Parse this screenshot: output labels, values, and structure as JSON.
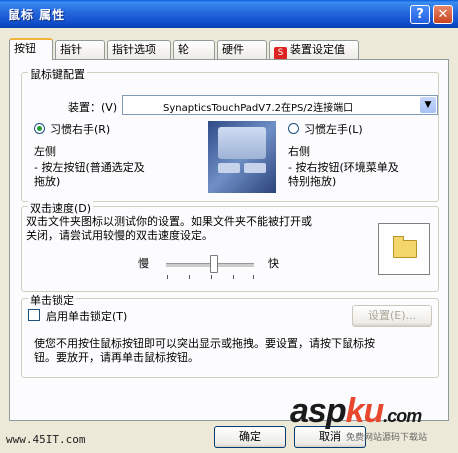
{
  "window": {
    "title": "鼠标 属性",
    "help_glyph": "?",
    "close_glyph": "✕"
  },
  "tabs": [
    {
      "label": "按钮"
    },
    {
      "label": "指针"
    },
    {
      "label": "指针选项"
    },
    {
      "label": "轮"
    },
    {
      "label": "硬件"
    },
    {
      "label": "装置设定值"
    }
  ],
  "mouse_config": {
    "legend": "鼠标键配置",
    "device_label": "装置：(V)",
    "device_value": "SynapticsTouchPadV7.2在PS/2连接端口",
    "right_hand": "习惯右手(R)",
    "left_hand": "习惯左手(L)",
    "left_title": "左侧",
    "left_desc_1": "- 按左按钮(普通选定及",
    "left_desc_2": "拖放)",
    "right_title": "右侧",
    "right_desc_1": "- 按右按钮(环境菜单及",
    "right_desc_2": "特别拖放)"
  },
  "double_click": {
    "legend": "双击速度(D)",
    "desc_1": "双击文件夹图标以测试你的设置。如果文件夹不能被打开或",
    "desc_2": "关闭，请尝试用较慢的双击速度设定。",
    "slow": "慢",
    "fast": "快",
    "speed_fraction": 0.55
  },
  "click_lock": {
    "legend": "单击锁定",
    "checkbox_label": "启用单击锁定(T)",
    "settings_button": "设置(E)...",
    "desc_1": "使您不用按住鼠标按钮即可以突出显示或拖拽。要设置，请按下鼠标按",
    "desc_2": "钮。要放开，请再单击鼠标按钮。"
  },
  "buttons": {
    "ok": "确定",
    "cancel": "取消"
  },
  "watermarks": {
    "left": "www.45IT.com",
    "brand_1": "asp",
    "brand_2": "ku",
    "brand_3": ".com",
    "sub": "免费网站源码下载站"
  }
}
